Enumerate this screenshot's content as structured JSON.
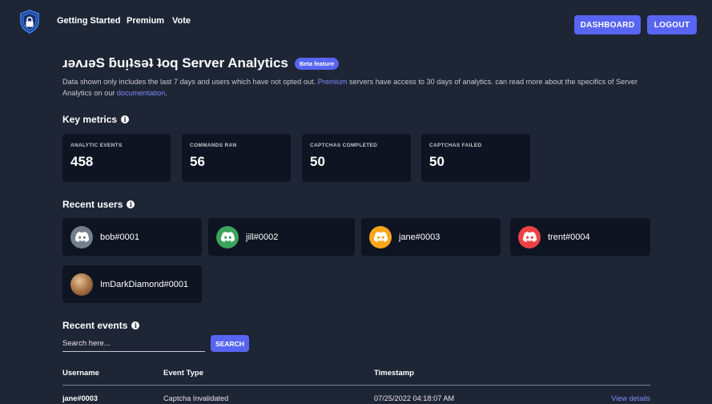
{
  "nav": {
    "links": [
      "Getting Started",
      "Premium",
      "Vote"
    ],
    "dashboard_label": "DASHBOARD",
    "logout_label": "LOGOUT"
  },
  "header": {
    "title": "ɹǝʌɹǝS ƃuᴉʇsǝʇ ʇoq Server Analytics",
    "badge": "Beta feature",
    "desc_1": "Data shown only includes the last 7 days and users which have not opted out. ",
    "premium_link": "Premium",
    "desc_2": " servers have access to 30 days of analytics. can read more about the specifics of Server Analytics on our ",
    "docs_link": "documentation",
    "desc_3": "."
  },
  "metrics": {
    "heading": "Key metrics",
    "items": [
      {
        "label": "ANALYTIC EVENTS",
        "value": "458"
      },
      {
        "label": "COMMANDS RAN",
        "value": "56"
      },
      {
        "label": "CAPTCHAS COMPLETED",
        "value": "50"
      },
      {
        "label": "CAPTCHAS FAILED",
        "value": "50"
      }
    ]
  },
  "users": {
    "heading": "Recent users",
    "items": [
      {
        "name": "bob#0001",
        "avatar_color": "#747f8d",
        "icon": "discord-icon"
      },
      {
        "name": "jill#0002",
        "avatar_color": "#3ba55c",
        "icon": "discord-icon"
      },
      {
        "name": "jane#0003",
        "avatar_color": "#faa61a",
        "icon": "discord-icon"
      },
      {
        "name": "trent#0004",
        "avatar_color": "#ed4245",
        "icon": "discord-icon"
      },
      {
        "name": "ImDarkDiamond#0001",
        "avatar_color": "#b07a4a",
        "icon": "photo-avatar"
      }
    ]
  },
  "events": {
    "heading": "Recent events",
    "search_placeholder": "Search here...",
    "search_label": "SEARCH",
    "columns": [
      "Username",
      "Event Type",
      "Timestamp"
    ],
    "rows": [
      {
        "username": "jane#0003",
        "event_type": "Captcha Invalidated",
        "timestamp": "07/25/2022 04:18:07 AM",
        "action": "View details"
      }
    ]
  },
  "colors": {
    "background": "#1e2535",
    "card": "#0f1422",
    "accent": "#5865f2",
    "link": "#7e8cf7"
  }
}
